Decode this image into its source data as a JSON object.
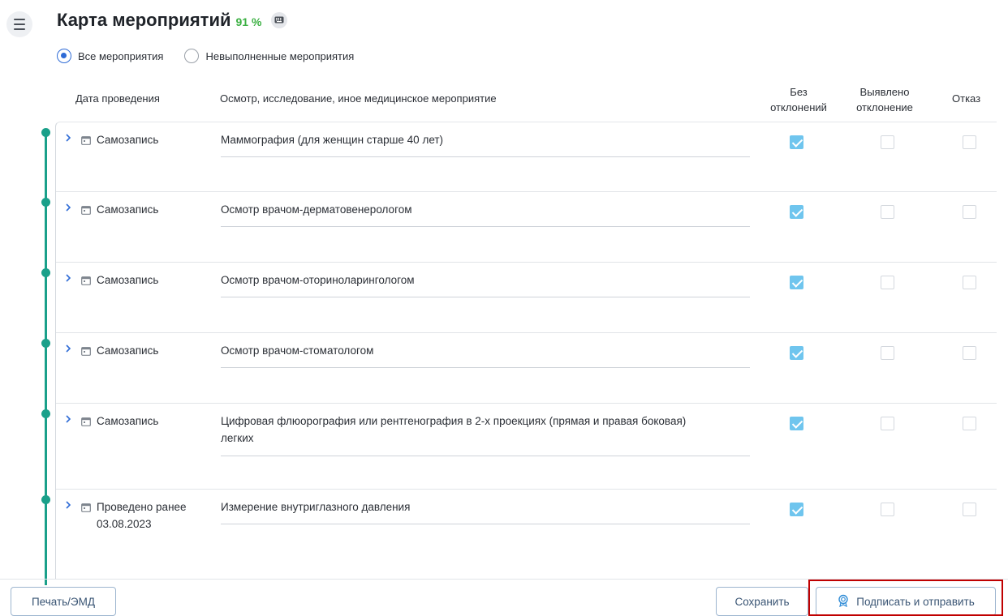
{
  "header": {
    "title": "Карта мероприятий",
    "progress_text": "91 %",
    "progress_percent": 91,
    "menu_icon": "hamburger-menu-icon",
    "keyboard_icon": "keyboard-icon"
  },
  "filters": {
    "all": "Все мероприятия",
    "incomplete": "Невыполненные мероприятия",
    "selected": "all"
  },
  "columns": {
    "date": "Дата проведения",
    "event": "Осмотр, исследование, иное медицинское мероприятие",
    "no_deviation_line1": "Без",
    "no_deviation_line2": "отклонений",
    "deviation_line1": "Выявлено",
    "deviation_line2": "отклонение",
    "refusal": "Отказ"
  },
  "rows": [
    {
      "date": "Самозапись",
      "date2": "",
      "event_line1": "Маммография (для женщин старше 40 лет)",
      "event_line2": "",
      "no_deviation": true,
      "deviation": false,
      "refusal": false
    },
    {
      "date": "Самозапись",
      "date2": "",
      "event_line1": "Осмотр врачом-дерматовенерологом",
      "event_line2": "",
      "no_deviation": true,
      "deviation": false,
      "refusal": false
    },
    {
      "date": "Самозапись",
      "date2": "",
      "event_line1": "Осмотр врачом-оториноларингологом",
      "event_line2": "",
      "no_deviation": true,
      "deviation": false,
      "refusal": false
    },
    {
      "date": "Самозапись",
      "date2": "",
      "event_line1": "Осмотр врачом-стоматологом",
      "event_line2": "",
      "no_deviation": true,
      "deviation": false,
      "refusal": false
    },
    {
      "date": "Самозапись",
      "date2": "",
      "event_line1": "Цифровая флюорография или рентгенография в 2-х проекциях (прямая и правая боковая)",
      "event_line2": "легких",
      "no_deviation": true,
      "deviation": false,
      "refusal": false
    },
    {
      "date": "Проведено ранее",
      "date2": "03.08.2023",
      "event_line1": "Измерение внутриглазного давления",
      "event_line2": "",
      "no_deviation": true,
      "deviation": false,
      "refusal": false
    }
  ],
  "footer": {
    "print_label": "Печать/ЭМД",
    "save_label": "Сохранить",
    "sign_label": "Подписать и отправить",
    "sign_icon": "certificate-icon"
  },
  "colors": {
    "accent": "#2e6bd6",
    "timeline": "#1aa08a",
    "progress": "#3cb043",
    "checked": "#6fc5ee",
    "highlight": "#c00000"
  }
}
